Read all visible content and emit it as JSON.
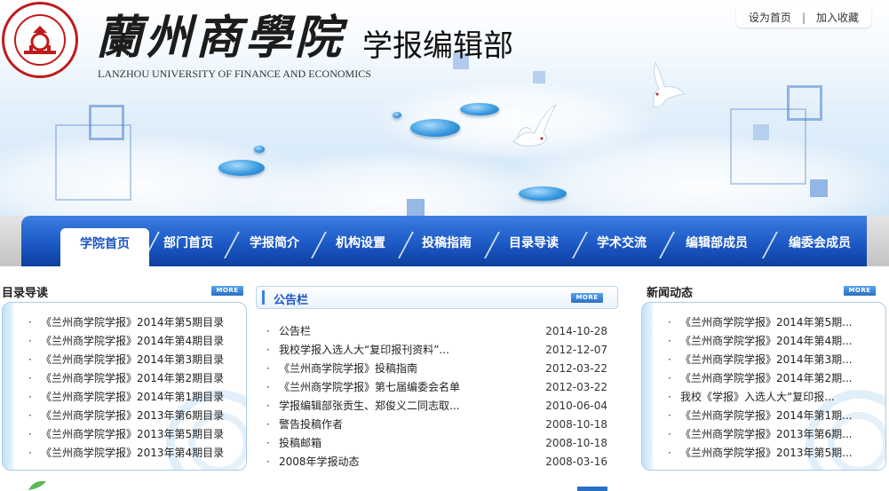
{
  "header": {
    "logo_label": "LANZHOU UNIVERSITY OF FINANCE AND ECONOMICS",
    "title_cn": "蘭州商學院",
    "title_sub": "学报编辑部",
    "title_en": "LANZHOU UNIVERSITY OF FINANCE AND ECONOMICS",
    "links": [
      "设为首页",
      "|",
      "加入收藏"
    ]
  },
  "nav": {
    "items": [
      "学院首页",
      "部门首页",
      "学报简介",
      "机构设置",
      "投稿指南",
      "目录导读",
      "学术交流",
      "编辑部成员",
      "编委会成员"
    ],
    "active_index": 0
  },
  "catalog": {
    "title": "目录导读",
    "more_label": "MORE",
    "items": [
      "《兰州商学院学报》2014年第5期目录",
      "《兰州商学院学报》2014年第4期目录",
      "《兰州商学院学报》2014年第3期目录",
      "《兰州商学院学报》2014年第2期目录",
      "《兰州商学院学报》2014年第1期目录",
      "《兰州商学院学报》2013年第6期目录",
      "《兰州商学院学报》2013年第5期目录",
      "《兰州商学院学报》2013年第4期目录"
    ]
  },
  "notice": {
    "title": "公告栏",
    "more_label": "MORE",
    "items": [
      {
        "text": "公告栏",
        "date": "2014-10-28"
      },
      {
        "text": "我校学报入选人大“复印报刊资料”...",
        "date": "2012-12-07"
      },
      {
        "text": "《兰州商学院学报》投稿指南",
        "date": "2012-03-22"
      },
      {
        "text": "《兰州商学院学报》第七届编委会名单",
        "date": "2012-03-22"
      },
      {
        "text": "学报编辑部张贡生、郑俊义二同志取...",
        "date": "2010-06-04"
      },
      {
        "text": "警告投稿作者",
        "date": "2008-10-18"
      },
      {
        "text": "投稿邮箱",
        "date": "2008-10-18"
      },
      {
        "text": "2008年学报动态",
        "date": "2008-03-16"
      }
    ]
  },
  "news": {
    "title": "新闻动态",
    "more_label": "MORE",
    "items": [
      "《兰州商学院学报》2014年第5期...",
      "《兰州商学院学报》2014年第4期...",
      "《兰州商学院学报》2014年第3期...",
      "《兰州商学院学报》2014年第2期...",
      "我校《学报》入选人大“复印报...",
      "《兰州商学院学报》2014年第1期...",
      "《兰州商学院学报》2013年第6期...",
      "《兰州商学院学报》2013年第5期..."
    ]
  },
  "bullet": "·",
  "colors": {
    "nav_blue": "#1a56c2",
    "accent": "#3b7ee0",
    "border": "#a9cbec"
  }
}
